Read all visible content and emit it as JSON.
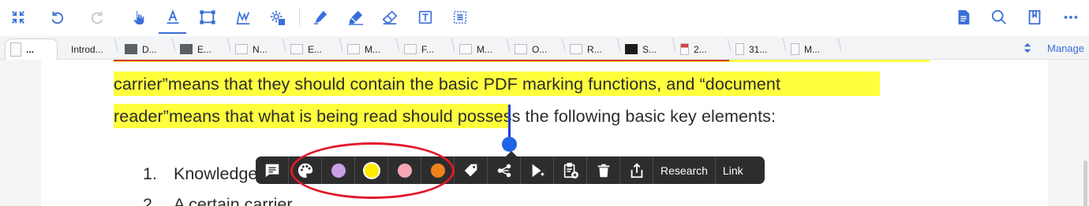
{
  "toolbar": {
    "left_tools": [
      "fullscreen-exit-icon",
      "undo-icon",
      "redo-icon",
      "hand-icon",
      "text-highlight-icon",
      "rectangle-select-icon",
      "signature-icon",
      "gear-settings-icon"
    ],
    "middle_tools": [
      "pen-icon",
      "highlighter-icon",
      "eraser-icon",
      "text-box-icon",
      "text-select-icon"
    ],
    "right_tools": [
      "document-icon",
      "search-icon",
      "bookmark-icon",
      "more-icon"
    ],
    "accent_color": "#3a6fd8"
  },
  "tabs": {
    "items": [
      {
        "label": "...",
        "active": true
      },
      {
        "label": "Introd..."
      },
      {
        "label": "D..."
      },
      {
        "label": "E..."
      },
      {
        "label": "N..."
      },
      {
        "label": "E..."
      },
      {
        "label": "M..."
      },
      {
        "label": "F..."
      },
      {
        "label": "M..."
      },
      {
        "label": "O..."
      },
      {
        "label": "R..."
      },
      {
        "label": "S..."
      },
      {
        "label": "2..."
      },
      {
        "label": "31..."
      },
      {
        "label": "M..."
      }
    ],
    "manage_label": "Manage"
  },
  "document": {
    "lines": [
      "carrier”means that they should contain the basic PDF marking functions, and “document",
      "reader”means that what is being read should possess the following basic key elements:"
    ],
    "list": [
      {
        "num": "1.",
        "text": "Knowledge and historical value or research value"
      },
      {
        "num": "2.",
        "text": "A certain carrier"
      }
    ],
    "highlight_color": "#ffff3d"
  },
  "popup": {
    "colors": [
      {
        "name": "purple",
        "hex": "#c8a0e6"
      },
      {
        "name": "yellow",
        "hex": "#ffee00"
      },
      {
        "name": "pink",
        "hex": "#f4a6b5"
      },
      {
        "name": "orange",
        "hex": "#f0821e"
      }
    ],
    "research_label": "Research",
    "link_label": "Link"
  }
}
